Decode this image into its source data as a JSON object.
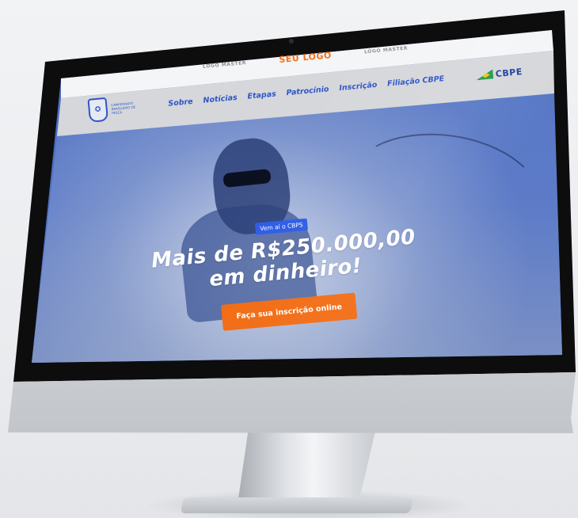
{
  "sponsors": {
    "left": "LOGO MASTER",
    "center": "SEU LOGO",
    "right": "LOGO MASTER"
  },
  "nav": {
    "brand_text": "CAMPEONATO BRASILEIRO DE PESCA",
    "items": [
      "Sobre",
      "Notícias",
      "Etapas",
      "Patrocínio",
      "Inscrição",
      "Filiação CBPE"
    ],
    "partner_logo": "CBPE"
  },
  "hero": {
    "badge": "Vem aí o CBPS",
    "headline_line1": "Mais de R$250.000,00",
    "headline_line2": "em dinheiro!",
    "cta": "Faça sua inscrição online"
  },
  "colors": {
    "primary_blue": "#2f55c8",
    "accent_orange": "#f26b12",
    "hero_blue": "#5476c6"
  }
}
